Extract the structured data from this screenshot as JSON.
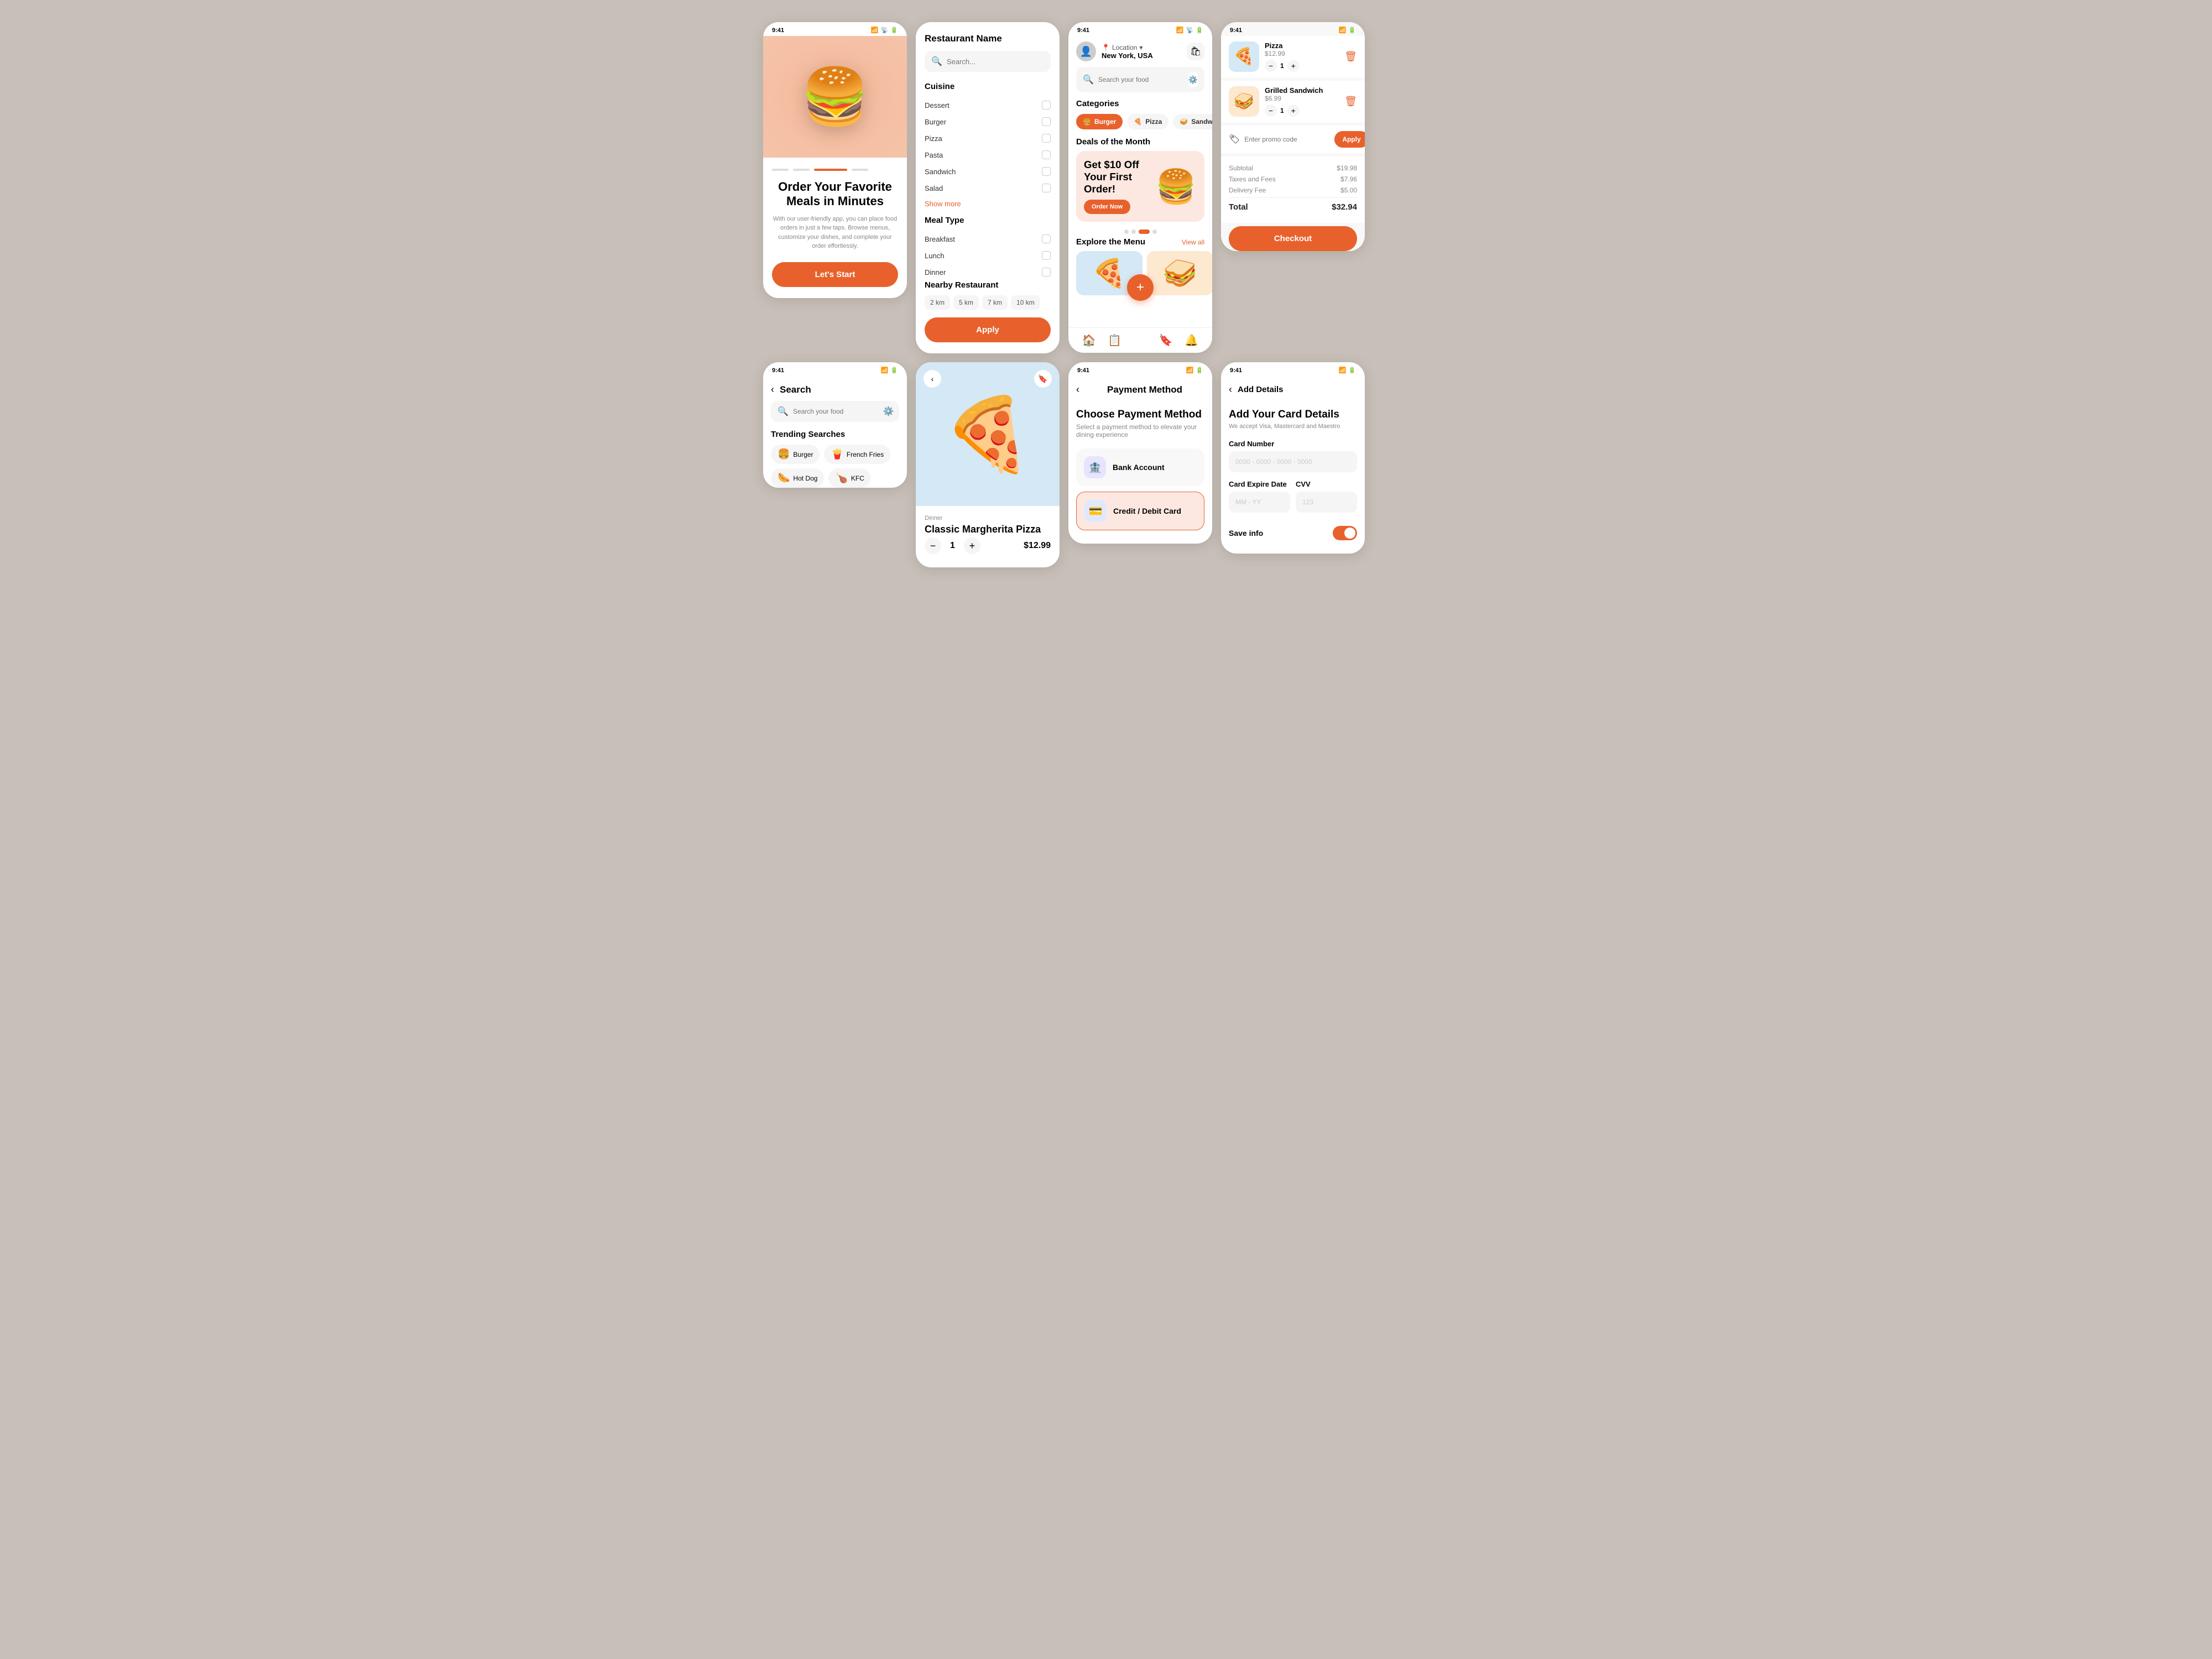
{
  "app": {
    "time": "9:41"
  },
  "onboarding": {
    "title": "Order Your Favorite Meals in Minutes",
    "description": "With our user-friendly app, you can place food orders in just a few taps. Browse menus, customize your dishes, and complete your order effortlessly.",
    "cta_label": "Let's Start",
    "hero_emoji": "🍔",
    "progress": [
      1,
      1,
      0,
      1
    ]
  },
  "filter": {
    "title": "Restaurant Name",
    "search_placeholder": "Search...",
    "cuisine_label": "Cuisine",
    "cuisine_items": [
      "Dessert",
      "Burger",
      "Pizza",
      "Pasta",
      "Sandwich",
      "Salad"
    ],
    "show_more_label": "Show more",
    "meal_type_label": "Meal Type",
    "meal_items": [
      "Breakfast",
      "Lunch",
      "Dinner"
    ],
    "nearby_label": "Nearby Restaurant",
    "distances": [
      "2 km",
      "5 km",
      "7 km",
      "10 km"
    ],
    "apply_label": "Apply"
  },
  "main_app": {
    "location_label": "Location",
    "location_name": "New York, USA",
    "search_placeholder": "Search your food",
    "categories_label": "Categories",
    "categories": [
      {
        "name": "Burger",
        "emoji": "🍔",
        "active": true
      },
      {
        "name": "Pizza",
        "emoji": "🍕",
        "active": false
      },
      {
        "name": "Sandwich",
        "emoji": "🥪",
        "active": false
      }
    ],
    "deals_label": "Deals of the Month",
    "deal_title": "Get $10 Off Your",
    "deal_subtitle": "First Order!",
    "deal_btn": "Order Now",
    "deal_emoji": "🍔",
    "explore_label": "Explore the Menu",
    "view_all_label": "View all",
    "menu_items": [
      "🍕",
      "🥪"
    ]
  },
  "pizza_detail": {
    "tag": "Dinner",
    "name": "Classic Margherita Pizza",
    "price": "$12.99",
    "quantity": 1,
    "hero_emoji": "🍕"
  },
  "cart": {
    "items": [
      {
        "name": "Pizza",
        "price": "$12.99",
        "emoji": "🍕",
        "bg": "pizza-bg",
        "qty": 1
      },
      {
        "name": "Grilled Sandwich",
        "price": "$6.99",
        "emoji": "🥪",
        "bg": "sandwich-bg",
        "qty": 1
      }
    ],
    "promo_placeholder": "Enter promo code",
    "apply_label": "Apply",
    "subtotal_label": "Subtotal",
    "subtotal": "$19.98",
    "taxes_label": "Taxes and Fees",
    "taxes": "$7.96",
    "delivery_label": "Delivery Fee",
    "delivery": "$5.00",
    "total_label": "Total",
    "total": "$32.94",
    "checkout_label": "Checkout"
  },
  "search_screen": {
    "title": "Search",
    "search_placeholder": "Search your food",
    "trending_label": "Trending Searches",
    "trending_items": [
      {
        "name": "Burger",
        "emoji": "🍔"
      },
      {
        "name": "French Fries",
        "emoji": "🍟"
      },
      {
        "name": "Hot Dog",
        "emoji": "🌭"
      },
      {
        "name": "KFC",
        "emoji": "🍗"
      }
    ]
  },
  "payment": {
    "nav_title": "Payment Method",
    "heading": "Choose Payment Method",
    "subtext": "Select a payment method to elevate your dining experience",
    "options": [
      {
        "name": "Bank Account",
        "emoji": "🏦",
        "bg": "bank"
      },
      {
        "name": "Credit / Debit Card",
        "emoji": "💳",
        "bg": "card"
      }
    ]
  },
  "add_details": {
    "nav_title": "Add Details",
    "heading": "Add Your Card Details",
    "subtext": "We accept Visa, Mastercard and Maestro",
    "card_number_label": "Card Number",
    "card_number_placeholder": "0000 - 0000 - 0000 - 0000",
    "expire_label": "Card Expire Date",
    "expire_placeholder": "MM - YY",
    "cvv_label": "CVV",
    "cvv_placeholder": "123",
    "save_label": "Save info"
  },
  "colors": {
    "primary": "#e8612c",
    "bg_gray": "#c8c0b8",
    "card_bg": "#ffffff",
    "light_bg": "#f5f5f5"
  }
}
